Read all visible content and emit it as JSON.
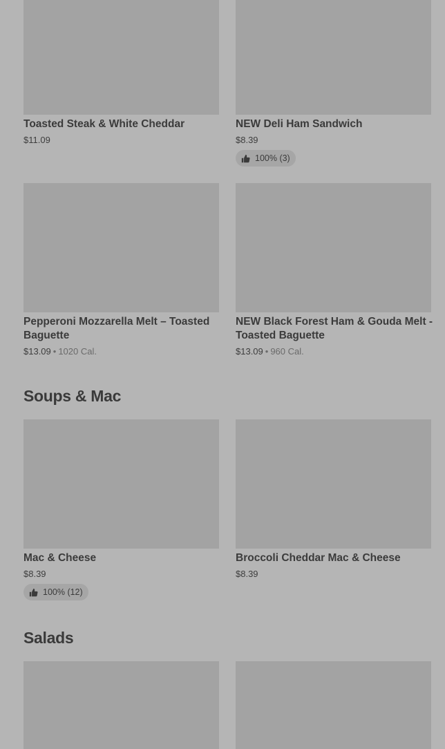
{
  "cards": [
    {
      "id": "c1",
      "title": "Toasted Steak & White Cheddar",
      "price": "$11.09"
    },
    {
      "id": "c2",
      "title": "NEW Deli Ham Sandwich",
      "price": "$8.39",
      "rating": "100% (3)"
    },
    {
      "id": "c3",
      "title": "Pepperoni Mozzarella Melt – Toasted Baguette",
      "price": "$13.09",
      "sep": "•",
      "calories": "1020 Cal."
    },
    {
      "id": "c4",
      "title": "NEW Black Forest Ham & Gouda Melt - Toasted Baguette",
      "price": "$13.09",
      "sep": "•",
      "calories": "960 Cal."
    },
    {
      "id": "c5",
      "title": "Mac & Cheese",
      "price": "$8.39",
      "rating": "100% (12)"
    },
    {
      "id": "c6",
      "title": "Broccoli Cheddar Mac & Cheese",
      "price": "$8.39"
    }
  ],
  "sections": {
    "soups": "Soups & Mac",
    "salads": "Salads"
  },
  "colors": {
    "background": "#b5b5b5",
    "image_placeholder": "#a3a3a3",
    "rating_pill": "#a6a6a6"
  },
  "icons": {
    "rating": "thumbs-up-icon"
  }
}
